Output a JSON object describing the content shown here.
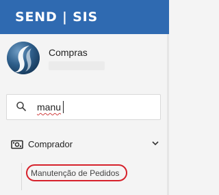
{
  "header": {
    "title": "SEND | SIS"
  },
  "user": {
    "name": "Compras"
  },
  "search": {
    "value": "manu"
  },
  "menu": {
    "item": {
      "label": "Comprador",
      "icon": "money-icon",
      "state": "expanded"
    },
    "subitems": [
      {
        "label": "Manutenção de Pedidos",
        "highlight_color": "#d6202a"
      }
    ]
  },
  "colors": {
    "header_bg": "#2f6ab1",
    "highlight": "#d6202a"
  }
}
